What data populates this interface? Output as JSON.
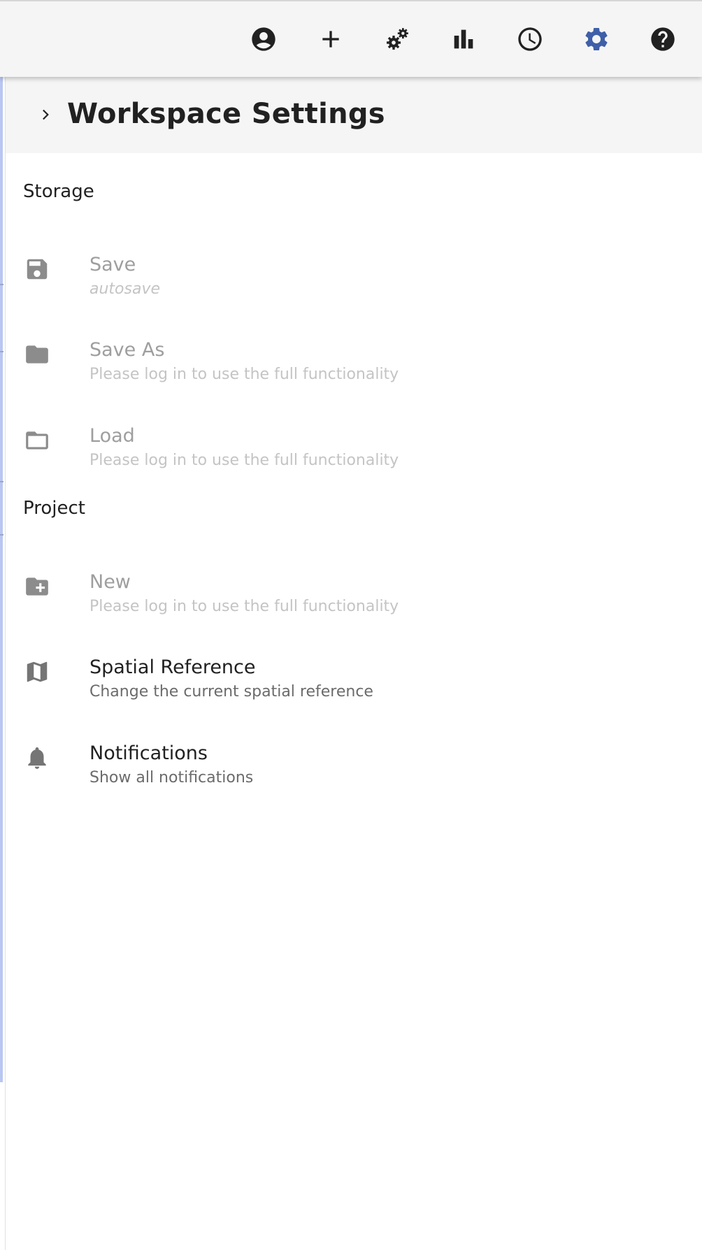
{
  "toolbar": {
    "accent_color": "#3f5fa8",
    "buttons": [
      {
        "icon": "account-circle-icon",
        "tooltip": ""
      },
      {
        "icon": "add-icon"
      },
      {
        "icon": "gears-icon"
      },
      {
        "icon": "bar-chart-icon"
      },
      {
        "icon": "clock-icon"
      },
      {
        "icon": "settings-icon",
        "active": true
      },
      {
        "icon": "help-icon"
      }
    ]
  },
  "panel": {
    "title": "Workspace Settings"
  },
  "sections": [
    {
      "title": "Storage",
      "items": [
        {
          "icon": "save-icon",
          "label": "Save",
          "sublabel": "autosave",
          "enabled": false
        },
        {
          "icon": "folder-icon",
          "label": "Save As",
          "sublabel": "Please log in to use the full functionality",
          "enabled": false
        },
        {
          "icon": "folder-open-icon",
          "label": "Load",
          "sublabel": "Please log in to use the full functionality",
          "enabled": false
        }
      ]
    },
    {
      "title": "Project",
      "items": [
        {
          "icon": "create-folder-icon",
          "label": "New",
          "sublabel": "Please log in to use the full functionality",
          "enabled": false
        },
        {
          "icon": "map-icon",
          "label": "Spatial Reference",
          "sublabel": "Change the current spatial reference",
          "enabled": true
        },
        {
          "icon": "bell-icon",
          "label": "Notifications",
          "sublabel": "Show all notifications",
          "enabled": true
        }
      ]
    }
  ]
}
